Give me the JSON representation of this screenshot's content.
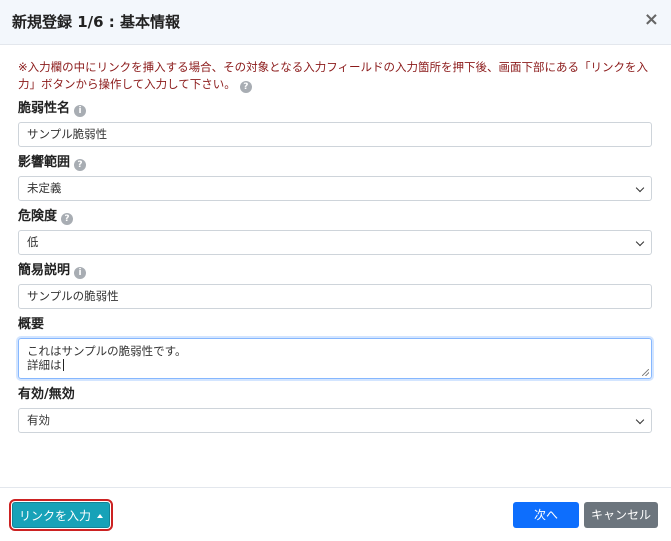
{
  "modal": {
    "title": "新規登録 1/6 : 基本情報",
    "close_symbol": "×"
  },
  "notice": "※入力欄の中にリンクを挿入する場合、その対象となる入力フィールドの入力箇所を押下後、画面下部にある「リンクを入力」ボタンから操作して入力して下さい。",
  "fields": {
    "vuln_name": {
      "label": "脆弱性名",
      "value": "サンプル脆弱性",
      "help_glyph": "i"
    },
    "impact": {
      "label": "影響範囲",
      "value": "未定義",
      "help_glyph": "?"
    },
    "severity": {
      "label": "危険度",
      "value": "低",
      "help_glyph": "?"
    },
    "summary": {
      "label": "簡易説明",
      "value": "サンプルの脆弱性",
      "help_glyph": "i"
    },
    "overview": {
      "label": "概要",
      "value": "これはサンプルの脆弱性です。\n詳細は"
    },
    "enabled": {
      "label": "有効/無効",
      "value": "有効"
    }
  },
  "notice_help_glyph": "?",
  "footer": {
    "link_button": "リンクを入力",
    "next_button": "次へ",
    "cancel_button": "キャンセル"
  },
  "colors": {
    "notice_text": "#8b1a1a",
    "link_button_bg": "#17a2b8",
    "link_button_highlight": "#cc2222",
    "next_button_bg": "#0d6efd",
    "cancel_button_bg": "#6c757d",
    "header_bg": "#f3f7fc"
  },
  "icons": {
    "close": "close-icon",
    "help": "help-circle-icon",
    "info": "info-circle-icon",
    "dropdown": "chevron-down-icon",
    "caret": "caret-up-icon"
  }
}
